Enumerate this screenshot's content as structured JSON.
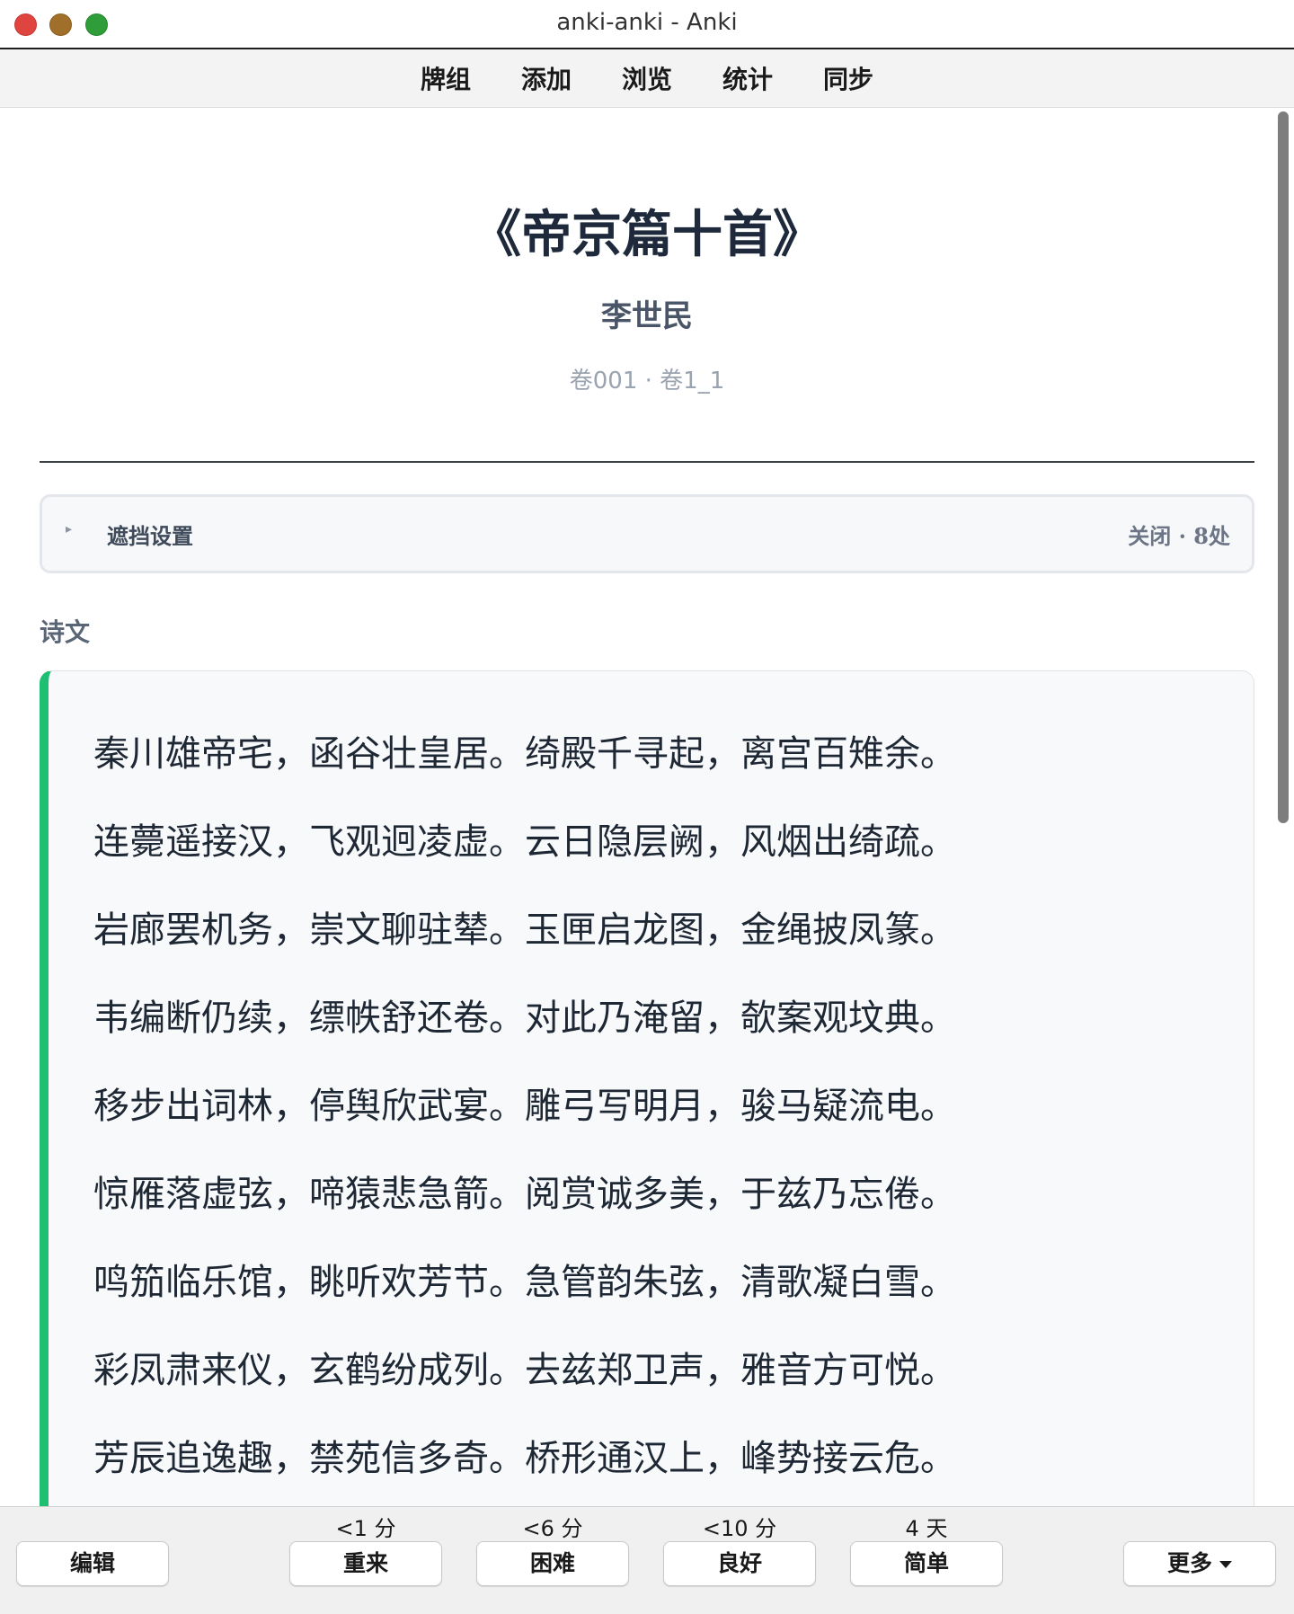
{
  "window": {
    "title": "anki-anki - Anki"
  },
  "nav": {
    "items": [
      "牌组",
      "添加",
      "浏览",
      "统计",
      "同步"
    ]
  },
  "card": {
    "title": "《帝京篇十首》",
    "author": "李世民",
    "volume": "卷001 · 卷1_1",
    "mask_panel": {
      "toggle_icon": "▸",
      "label": "遮挡设置",
      "status": "关闭 · 8处"
    },
    "section_label": "诗文",
    "lines": [
      "秦川雄帝宅，函谷壮皇居。绮殿千寻起，离宫百雉余。",
      "连薨遥接汉，飞观迥凌虚。云日隐层阙，风烟出绮疏。",
      "岩廊罢机务，崇文聊驻辇。玉匣启龙图，金绳披凤篆。",
      "韦编断仍续，缥帙舒还卷。对此乃淹留，欹案观坟典。",
      "移步出词林，停舆欣武宴。雕弓写明月，骏马疑流电。",
      "惊雁落虚弦，啼猿悲急箭。阅赏诚多美，于兹乃忘倦。",
      "鸣笳临乐馆，眺听欢芳节。急管韵朱弦，清歌凝白雪。",
      "彩凤肃来仪，玄鹤纷成列。去兹郑卫声，雅音方可悦。",
      "芳辰追逸趣，禁苑信多奇。桥形通汉上，峰势接云危。"
    ]
  },
  "bottombar": {
    "edit_label": "编辑",
    "more_label": "更多",
    "answers": [
      {
        "label": "重来",
        "interval": "<1 分"
      },
      {
        "label": "困难",
        "interval": "<6 分"
      },
      {
        "label": "良好",
        "interval": "<10 分"
      },
      {
        "label": "简单",
        "interval": "4 天"
      }
    ]
  },
  "colors": {
    "accent_border": "#1fbf73",
    "close": "#e0443e",
    "minimize": "#a0702b",
    "zoom": "#2f9e3a"
  }
}
